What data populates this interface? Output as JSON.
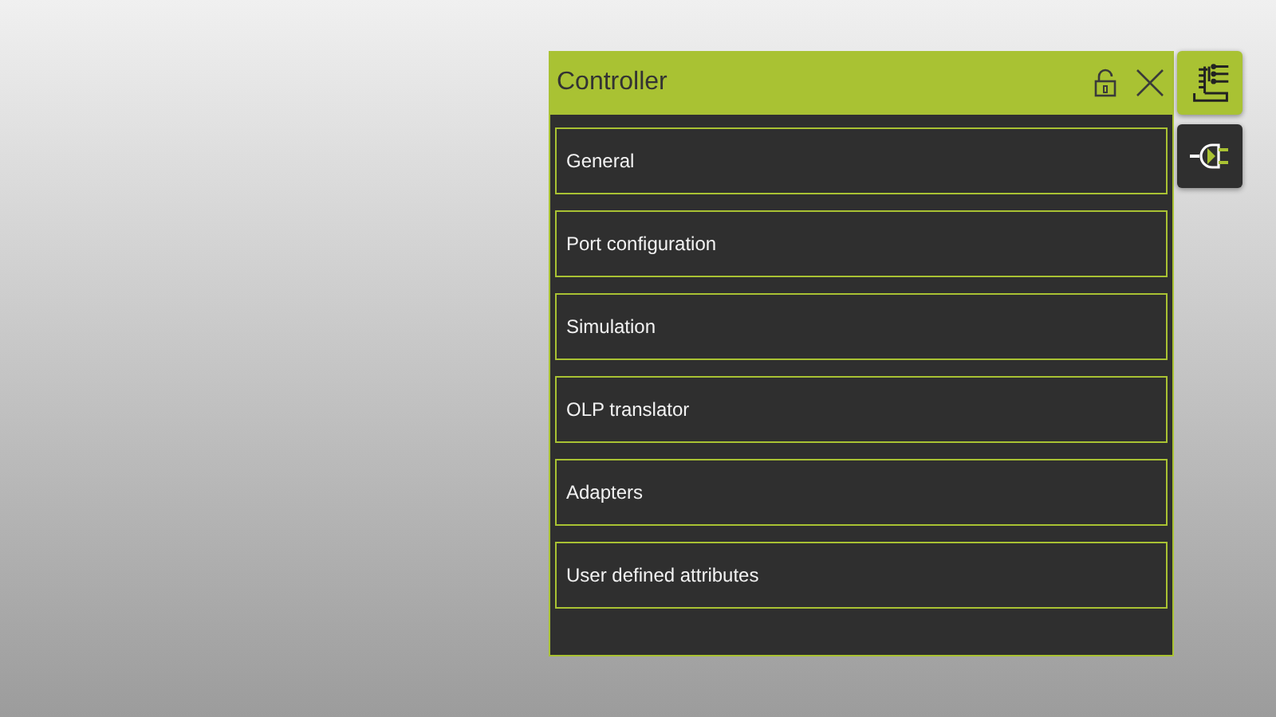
{
  "panel": {
    "title": "Controller",
    "locked": false
  },
  "sections": [
    {
      "label": "General"
    },
    {
      "label": "Port configuration"
    },
    {
      "label": "Simulation"
    },
    {
      "label": "OLP translator"
    },
    {
      "label": "Adapters"
    },
    {
      "label": "User defined attributes"
    }
  ],
  "side_tabs": [
    {
      "kind": "controller",
      "selected": true
    },
    {
      "kind": "signal",
      "selected": false
    }
  ]
}
